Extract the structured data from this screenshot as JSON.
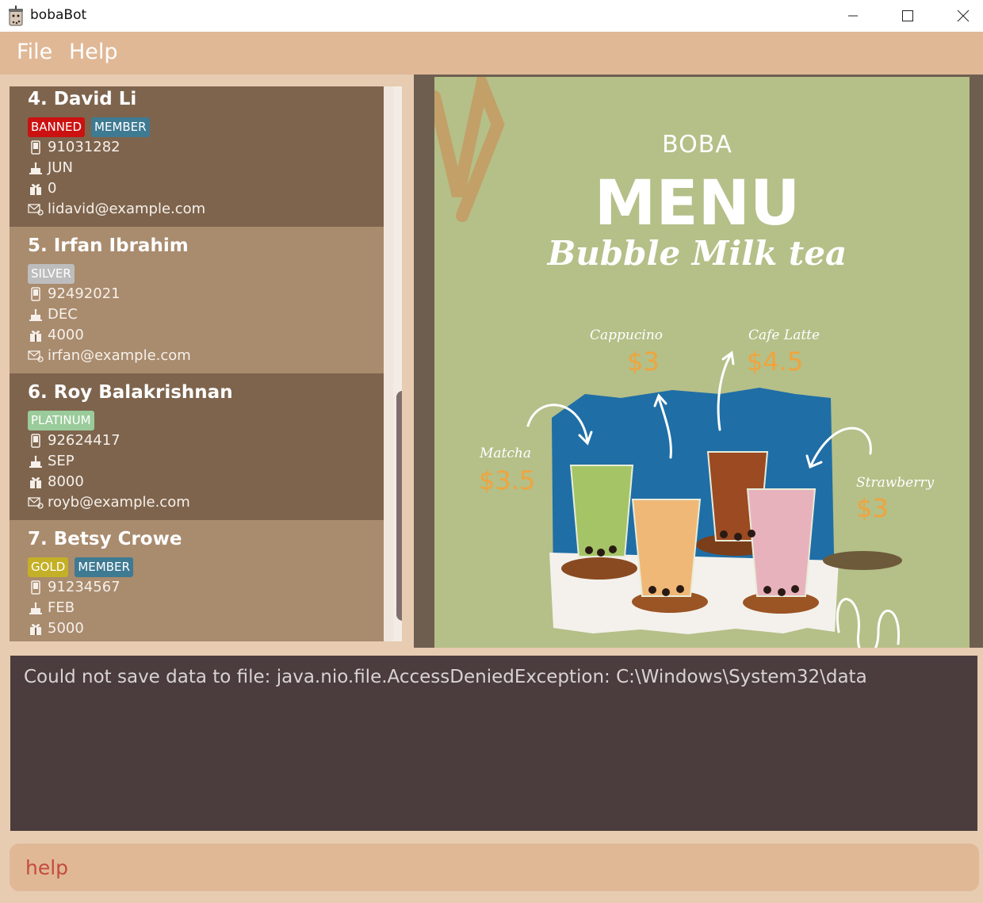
{
  "window": {
    "title": "bobaBot"
  },
  "menu": {
    "items": [
      "File",
      "Help"
    ]
  },
  "people": [
    {
      "index": "4.",
      "name": "David Li",
      "tags": [
        {
          "label": "BANNED",
          "kind": "banned"
        },
        {
          "label": "MEMBER",
          "kind": "member"
        }
      ],
      "phone": "91031282",
      "birthday": "JUN",
      "points": "0",
      "email": "lidavid@example.com",
      "shade": "dark"
    },
    {
      "index": "5.",
      "name": "Irfan Ibrahim",
      "tags": [
        {
          "label": "SILVER",
          "kind": "silver"
        }
      ],
      "phone": "92492021",
      "birthday": "DEC",
      "points": "4000",
      "email": "irfan@example.com",
      "shade": "light"
    },
    {
      "index": "6.",
      "name": "Roy Balakrishnan",
      "tags": [
        {
          "label": "PLATINUM",
          "kind": "platinum"
        }
      ],
      "phone": "92624417",
      "birthday": "SEP",
      "points": "8000",
      "email": "royb@example.com",
      "shade": "dark"
    },
    {
      "index": "7.",
      "name": "Betsy Crowe",
      "tags": [
        {
          "label": "GOLD",
          "kind": "gold"
        },
        {
          "label": "MEMBER",
          "kind": "member"
        }
      ],
      "phone": "91234567",
      "birthday": "FEB",
      "points": "5000",
      "email": "",
      "shade": "light"
    }
  ],
  "icons": {
    "phone": "phone-icon",
    "birthday": "cake-icon",
    "points": "gift-icon",
    "email": "mail-icon"
  },
  "menu_image": {
    "brand": "BOBA",
    "headline": "MENU",
    "subtitle": "Bubble Milk tea",
    "items": [
      {
        "name": "Cappucino",
        "price": "$3"
      },
      {
        "name": "Cafe Latte",
        "price": "$4.5"
      },
      {
        "name": "Matcha",
        "price": "$3.5"
      },
      {
        "name": "Strawberry",
        "price": "$3"
      }
    ]
  },
  "result": {
    "message": "Could not save data to file: java.nio.file.AccessDeniedException: C:\\Windows\\System32\\data"
  },
  "command": {
    "value": "help"
  },
  "colors": {
    "banned": "#cc1111",
    "member": "#3f7a93",
    "silver": "#bdbdbd",
    "platinum": "#9acb9a",
    "gold": "#c4b026"
  }
}
